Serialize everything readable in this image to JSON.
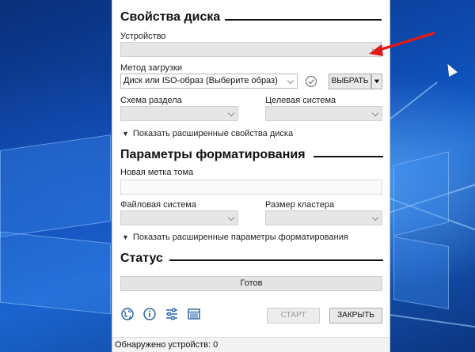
{
  "app": {
    "disk_section_title": "Свойства диска",
    "device_label": "Устройство",
    "device_value": "",
    "boot_method_label": "Метод загрузки",
    "boot_method_value": "Диск или ISO-образ (Выберите образ)",
    "select_button": "ВЫБРАТЬ",
    "partition_scheme_label": "Схема раздела",
    "target_system_label": "Целевая система",
    "show_advanced_disk": "Показать расширенные свойства диска",
    "format_section_title": "Параметры форматирования",
    "volume_label_label": "Новая метка тома",
    "volume_label_value": "",
    "file_system_label": "Файловая система",
    "cluster_size_label": "Размер кластера",
    "show_advanced_format": "Показать расширенные параметры форматирования",
    "status_section_title": "Статус",
    "status_text": "Готов",
    "start_button": "СТАРТ",
    "close_button": "ЗАКРЫТЬ",
    "statusbar_text": "Обнаружено устройств: 0"
  },
  "icons": [
    "globe-icon",
    "info-icon",
    "settings-sliders-icon",
    "log-table-icon",
    "check-circle-icon",
    "cursor-icon"
  ],
  "colors": {
    "annotation_arrow": "#e0191b",
    "desktop": "#0e4fb8"
  }
}
